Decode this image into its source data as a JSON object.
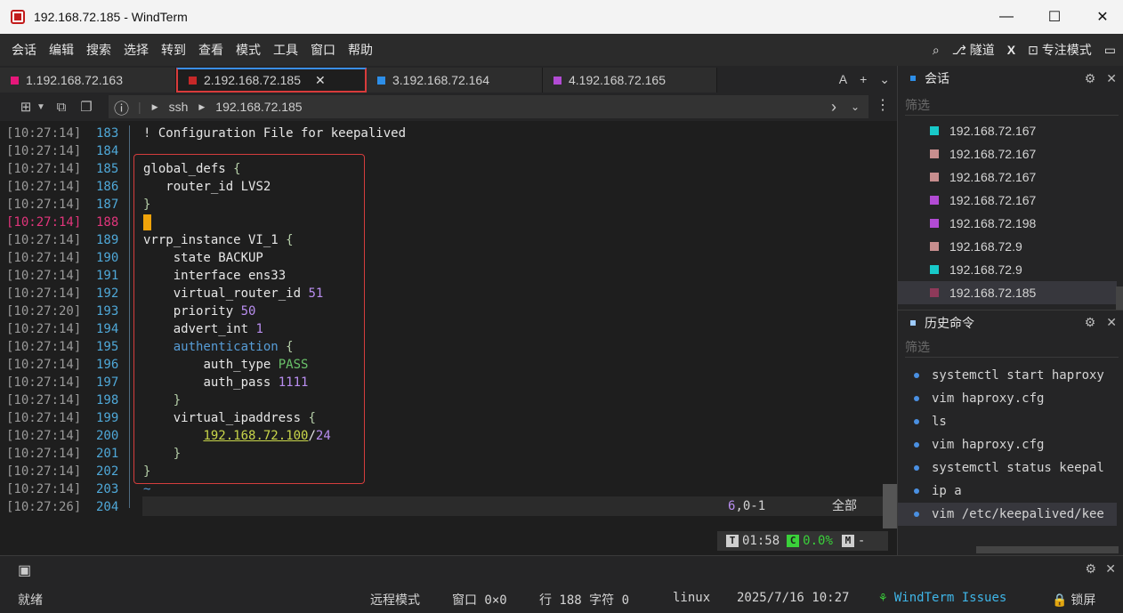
{
  "window": {
    "title": "192.168.72.185 - WindTerm"
  },
  "menu": [
    "会话",
    "编辑",
    "搜索",
    "选择",
    "转到",
    "查看",
    "模式",
    "工具",
    "窗口",
    "帮助"
  ],
  "menu_right": {
    "tunnel": "隧道",
    "x": "X",
    "focus": "专注模式"
  },
  "tabs": [
    {
      "label": "1.192.168.72.163",
      "color": "#e6177a"
    },
    {
      "label": "2.192.168.72.185",
      "color": "#c62828",
      "active": true
    },
    {
      "label": "3.192.168.72.164",
      "color": "#2d8ee8"
    },
    {
      "label": "4.192.168.72.165",
      "color": "#b24bd4"
    }
  ],
  "tab_tools": {
    "font": "A",
    "add": "+",
    "menu": "⌄"
  },
  "address": {
    "protocol": "ssh",
    "host": "192.168.72.185"
  },
  "terminal": {
    "lines": [
      {
        "ts": "[10:27:14]",
        "ln": "183"
      },
      {
        "ts": "[10:27:14]",
        "ln": "184"
      },
      {
        "ts": "[10:27:14]",
        "ln": "185"
      },
      {
        "ts": "[10:27:14]",
        "ln": "186"
      },
      {
        "ts": "[10:27:14]",
        "ln": "187"
      },
      {
        "ts": "[10:27:14]",
        "ln": "188",
        "hl": true
      },
      {
        "ts": "[10:27:14]",
        "ln": "189"
      },
      {
        "ts": "[10:27:14]",
        "ln": "190"
      },
      {
        "ts": "[10:27:14]",
        "ln": "191"
      },
      {
        "ts": "[10:27:14]",
        "ln": "192"
      },
      {
        "ts": "[10:27:20]",
        "ln": "193"
      },
      {
        "ts": "[10:27:14]",
        "ln": "194"
      },
      {
        "ts": "[10:27:14]",
        "ln": "195"
      },
      {
        "ts": "[10:27:14]",
        "ln": "196"
      },
      {
        "ts": "[10:27:14]",
        "ln": "197"
      },
      {
        "ts": "[10:27:14]",
        "ln": "198"
      },
      {
        "ts": "[10:27:14]",
        "ln": "199"
      },
      {
        "ts": "[10:27:14]",
        "ln": "200"
      },
      {
        "ts": "[10:27:14]",
        "ln": "201"
      },
      {
        "ts": "[10:27:14]",
        "ln": "202"
      },
      {
        "ts": "[10:27:14]",
        "ln": "203"
      },
      {
        "ts": "[10:27:26]",
        "ln": "204"
      }
    ],
    "code": {
      "comment": "! Configuration File for keepalived",
      "global_defs": "global_defs",
      "router_id": "router_id LVS2",
      "vrrp_instance": "vrrp_instance VI_1",
      "state": "state BACKUP",
      "interface": "interface ens33",
      "vrid_key": "virtual_router_id",
      "vrid_val": "51",
      "priority_key": "priority",
      "priority_val": "50",
      "advert_key": "advert_int",
      "advert_val": "1",
      "auth": "authentication",
      "auth_type_key": "auth_type",
      "auth_type_val": "PASS",
      "auth_pass_key": "auth_pass",
      "auth_pass_val": "1111",
      "vip": "virtual_ipaddress",
      "vip_ip": "192.168.72.100",
      "vip_mask": "24",
      "tilde": "~"
    },
    "vim_status": {
      "pos_a": "6",
      "pos_b": ",0-1",
      "scope": "全部"
    },
    "info": {
      "time": "01:58",
      "cpu": "0.0%",
      "mem": "-"
    }
  },
  "sessions_panel": {
    "title": "会话",
    "filter": "筛选",
    "items": [
      {
        "ip": "192.168.72.167",
        "color": "#18c9c9"
      },
      {
        "ip": "192.168.72.167",
        "color": "#c78e8e"
      },
      {
        "ip": "192.168.72.167",
        "color": "#c78e8e"
      },
      {
        "ip": "192.168.72.167",
        "color": "#b24bd4"
      },
      {
        "ip": "192.168.72.198",
        "color": "#b24bd4"
      },
      {
        "ip": "192.168.72.9",
        "color": "#c78e8e"
      },
      {
        "ip": "192.168.72.9",
        "color": "#18c9c9"
      },
      {
        "ip": "192.168.72.185",
        "color": "#8e3a5a",
        "active": true
      }
    ]
  },
  "history_panel": {
    "title": "历史命令",
    "filter": "筛选",
    "items": [
      "systemctl start haproxy",
      "vim haproxy.cfg",
      "ls",
      "vim haproxy.cfg",
      "systemctl status keepal",
      "ip a",
      "vim /etc/keepalived/kee"
    ]
  },
  "statusbar": {
    "ready": "就绪",
    "mode": "远程模式",
    "window": "窗口 0×0",
    "cursor": "行 188 字符 0",
    "os": "linux",
    "datetime": "2025/7/16 10:27",
    "issues": "WindTerm Issues",
    "lock": "锁屏"
  }
}
